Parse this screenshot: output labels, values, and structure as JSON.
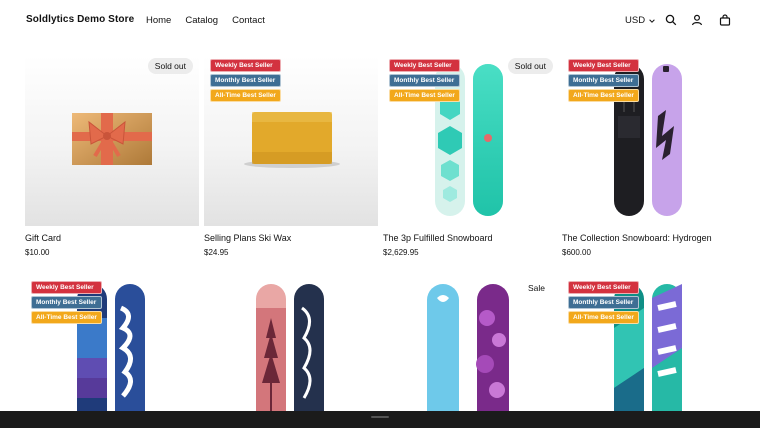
{
  "header": {
    "brand": "Soldlytics Demo Store",
    "nav": [
      "Home",
      "Catalog",
      "Contact"
    ],
    "currency": "USD",
    "icons": [
      "search-icon",
      "account-icon",
      "cart-icon"
    ]
  },
  "badges": {
    "sold_out": "Sold out",
    "sale": "Sale",
    "weekly": "Weekly Best Seller",
    "monthly": "Monthly Best Seller",
    "all_time": "All-Time Best Seller"
  },
  "products": [
    {
      "title": "Gift Card",
      "price": "$10.00"
    },
    {
      "title": "Selling Plans Ski Wax",
      "price": "$24.95"
    },
    {
      "title": "The 3p Fulfilled Snowboard",
      "price": "$2,629.95"
    },
    {
      "title": "The Collection Snowboard: Hydrogen",
      "price": "$600.00"
    }
  ],
  "colors": {
    "weekly": "#d3323f",
    "monthly": "#3e6e94",
    "all_time": "#f2a81b"
  }
}
